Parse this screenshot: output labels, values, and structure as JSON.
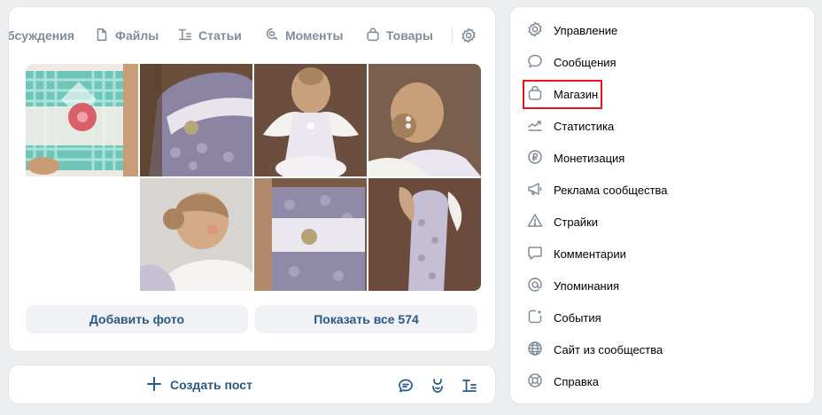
{
  "tabs": [
    {
      "label": "бсуждения",
      "icon": "discussions-icon"
    },
    {
      "label": "Файлы",
      "icon": "file-icon"
    },
    {
      "label": "Статьи",
      "icon": "article-icon"
    },
    {
      "label": "Моменты",
      "icon": "clip-icon"
    },
    {
      "label": "Товары",
      "icon": "bag-icon"
    }
  ],
  "photos": {
    "add_label": "Добавить фото",
    "show_all_label": "Показать все 574"
  },
  "create_post": {
    "label": "Создать пост"
  },
  "menu": [
    {
      "label": "Управление",
      "icon": "gear-icon"
    },
    {
      "label": "Сообщения",
      "icon": "message-icon"
    },
    {
      "label": "Магазин",
      "icon": "bag-icon"
    },
    {
      "label": "Статистика",
      "icon": "stats-icon"
    },
    {
      "label": "Монетизация",
      "icon": "ruble-icon"
    },
    {
      "label": "Реклама сообщества",
      "icon": "megaphone-icon"
    },
    {
      "label": "Страйки",
      "icon": "warning-icon"
    },
    {
      "label": "Комментарии",
      "icon": "comment-icon"
    },
    {
      "label": "Упоминания",
      "icon": "at-icon"
    },
    {
      "label": "События",
      "icon": "event-icon"
    },
    {
      "label": "Сайт из сообщества",
      "icon": "globe-icon"
    },
    {
      "label": "Справка",
      "icon": "help-icon"
    }
  ],
  "colors": {
    "accent": "#2a5885",
    "icon": "#818c99",
    "highlight": "#e6141e"
  }
}
